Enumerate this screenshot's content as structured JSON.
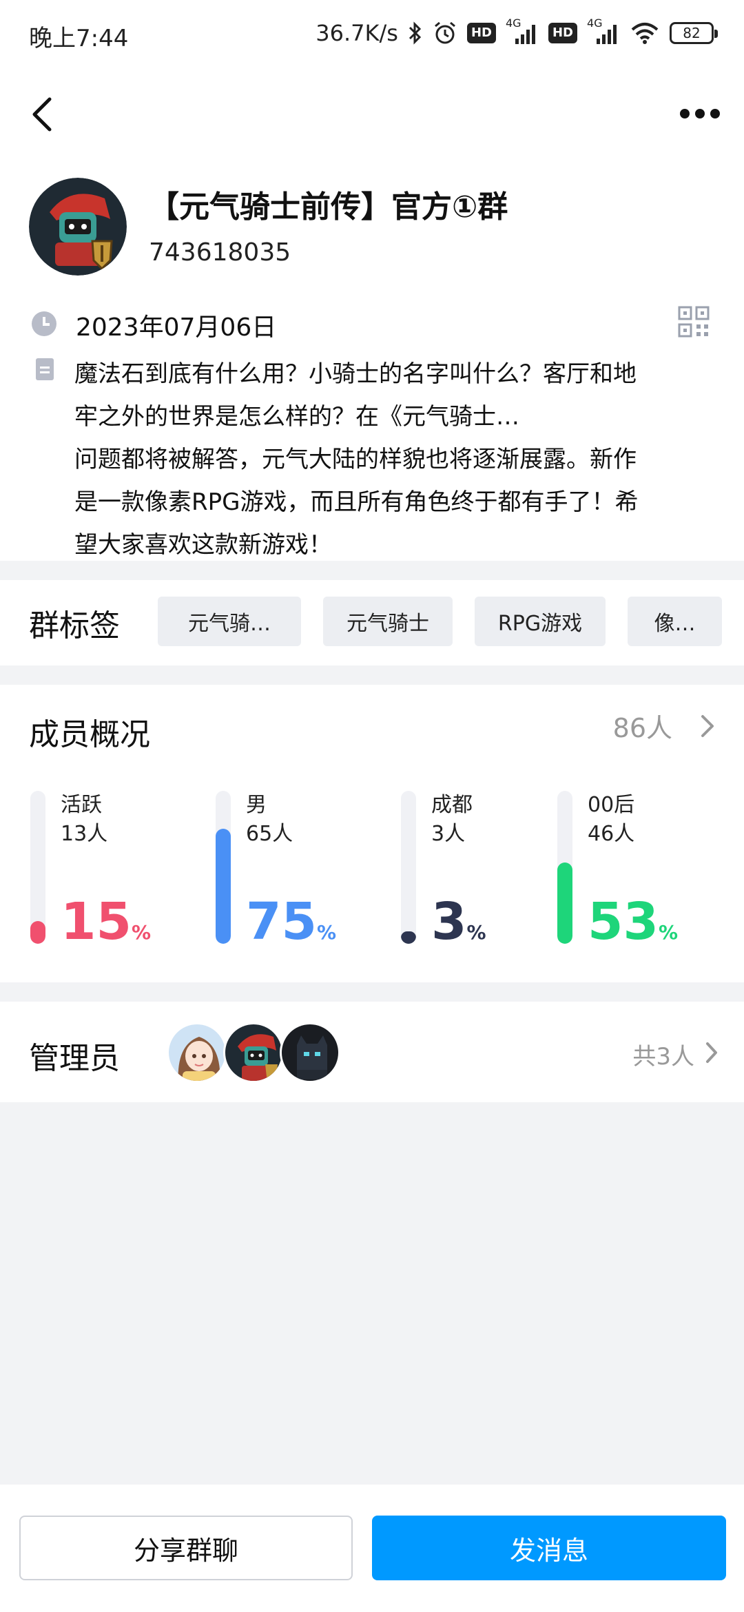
{
  "status_bar": {
    "time": "晚上7:44",
    "net_speed": "36.7K/s",
    "battery": "82",
    "net1": "4G",
    "net2": "4G",
    "hd": "HD"
  },
  "header": {
    "back_icon": "chevron-left-icon",
    "more_icon": "more-dots-icon"
  },
  "group": {
    "name": "【元气骑士前传】官方①群",
    "id": "743618035",
    "date": "2023年07月06日",
    "description_lines": [
      "魔法石到底有什么用？小骑士的名字叫什么？客厅和地",
      "牢之外的世界是怎么样的？在《元气骑士…",
      "问题都将被解答，元气大陆的样貌也将逐渐展露。新作",
      "是一款像素RPG游戏，而且所有角色终于都有手了！希",
      "望大家喜欢这款新游戏！"
    ]
  },
  "tags": {
    "title": "群标签",
    "items": [
      "元气骑…",
      "元气骑士",
      "RPG游戏",
      "像…"
    ]
  },
  "members": {
    "title": "成员概况",
    "total": "86人",
    "stats": [
      {
        "label": "活跃",
        "count": "13人",
        "percent": "15",
        "unit": "%",
        "fraction": 0.15,
        "color": "#f0506e"
      },
      {
        "label": "男",
        "count": "65人",
        "percent": "75",
        "unit": "%",
        "fraction": 0.75,
        "color": "#4a90f5"
      },
      {
        "label": "成都",
        "count": "3人",
        "percent": "3",
        "unit": "%",
        "fraction": 0.03,
        "color": "#2d3550"
      },
      {
        "label": "00后",
        "count": "46人",
        "percent": "53",
        "unit": "%",
        "fraction": 0.53,
        "color": "#1ed57a"
      }
    ]
  },
  "admins": {
    "title": "管理员",
    "count": "共3人"
  },
  "buttons": {
    "share": "分享群聊",
    "send": "发消息"
  }
}
